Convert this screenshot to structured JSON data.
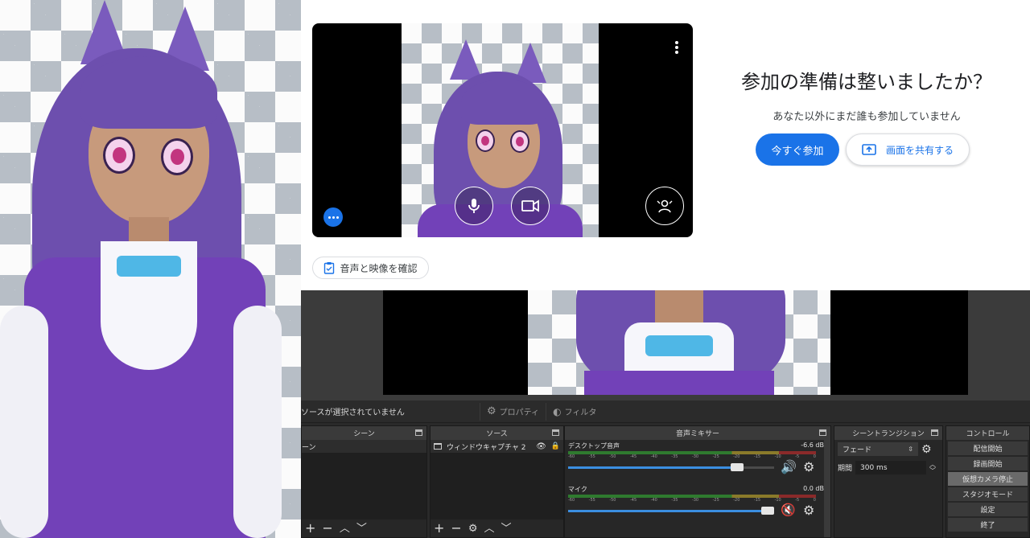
{
  "meet": {
    "title": "参加の準備は整いましたか？",
    "subtitle": "あなた以外にまだ誰も参加していません",
    "join_label": "今すぐ参加",
    "share_label": "画面を共有する",
    "check_label": "音声と映像を確認"
  },
  "obs": {
    "status_text": "ソースが選択されていません",
    "properties_label": "プロパティ",
    "filters_label": "フィルタ",
    "docks": {
      "scenes": {
        "title": "シーン",
        "item": "ーン"
      },
      "sources": {
        "title": "ソース",
        "item": "ウィンドウキャプチャ 2"
      },
      "mixer": {
        "title": "音声ミキサー",
        "channels": [
          {
            "name": "デスクトップ音声",
            "db": "-6.6 dB",
            "level": 0.82,
            "muted": false
          },
          {
            "name": "マイク",
            "db": "0.0 dB",
            "level": 1.0,
            "muted": true
          }
        ],
        "scale": [
          "-60",
          "-55",
          "-50",
          "-45",
          "-40",
          "-35",
          "-30",
          "-25",
          "-20",
          "-15",
          "-10",
          "-5",
          "0"
        ]
      },
      "transitions": {
        "title": "シーントランジション",
        "transition": "フェード",
        "duration_label": "期間",
        "duration_value": "300 ms"
      },
      "controls": {
        "title": "コントロール",
        "buttons": [
          "配信開始",
          "録画開始",
          "仮想カメラ停止",
          "スタジオモード",
          "設定",
          "終了"
        ]
      }
    }
  }
}
